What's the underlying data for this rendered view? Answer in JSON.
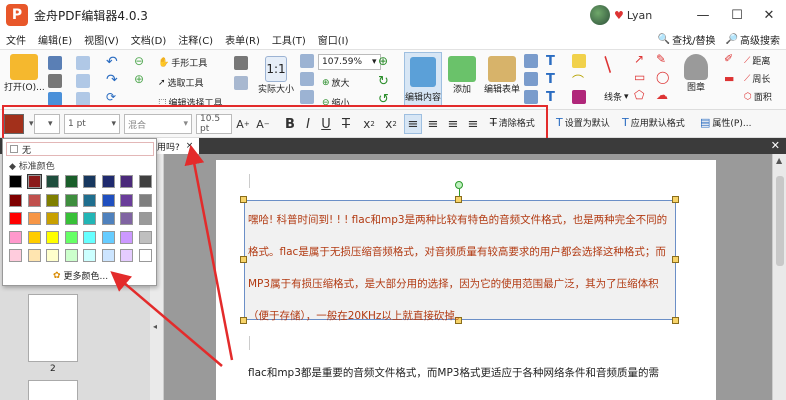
{
  "window": {
    "title": "金舟PDF编辑器4.0.3",
    "logo_letter": "P",
    "username": "Lyan",
    "minimize": "—",
    "maximize": "☐",
    "close": "✕"
  },
  "menu": {
    "items": [
      "文件",
      "编辑(E)",
      "视图(V)",
      "文档(D)",
      "注释(C)",
      "表单(R)",
      "工具(T)",
      "窗口(I)"
    ],
    "find_replace": "查找/替换",
    "advanced_search": "高级搜索"
  },
  "ribbon": {
    "open": "打开(O)...",
    "hand_tool": "手形工具",
    "select_tool": "选取工具",
    "edit_select_tool": "编辑选择工具",
    "actual_size": "实际大小",
    "zoom_value": "107.59%",
    "zoom_in": "放大",
    "zoom_out": "缩小",
    "edit_content": "编辑内容",
    "add": "添加",
    "edit_form": "编辑表单",
    "line": "线条",
    "stamp": "图章",
    "distance": "距离",
    "perimeter": "周长",
    "area": "面积"
  },
  "format": {
    "fill_label": "",
    "line_width": "1 pt",
    "blend": "混合",
    "font_size": "10.5 pt",
    "clear_format": "清除格式",
    "set_default": "设置为默认",
    "apply_default": "应用默认格式",
    "properties": "属性(P)..."
  },
  "tab": {
    "title": "好用吗?",
    "close": "×"
  },
  "color_popup": {
    "none_label": "无",
    "standard_colors": "标准颜色",
    "more_colors": "更多颜色...",
    "swatches": [
      [
        "#000000",
        "#8b1a1a",
        "#1f4e3d",
        "#1a5e2a",
        "#17375e",
        "#1f2a6e",
        "#4b2a7a",
        "#404040"
      ],
      [
        "#7f0000",
        "#c0504d",
        "#7f7f00",
        "#3e8e3e",
        "#1f6e8e",
        "#1f4fbf",
        "#6a3d9a",
        "#7f7f7f"
      ],
      [
        "#ff0000",
        "#f79646",
        "#c8a000",
        "#38c038",
        "#22b5b5",
        "#4f81bd",
        "#8064a2",
        "#9a9a9a"
      ],
      [
        "#ff99cc",
        "#ffcc00",
        "#ffff00",
        "#66ff66",
        "#66ffff",
        "#66ccff",
        "#cc99ff",
        "#bfbfbf"
      ],
      [
        "#ffccdd",
        "#ffe5b0",
        "#ffffcc",
        "#ccffcc",
        "#ccffff",
        "#cce5ff",
        "#e5ccff",
        "#ffffff"
      ]
    ]
  },
  "document": {
    "para1": "嘿哈! 科普时间到! ! ! flac和mp3是两种比较有特色的音频文件格式，也是两种完全不同的格式。flac是属于无损压缩音频格式，对音频质量有较高要求的用户都会选择这种格式；而MP3属于有损压缩格式，是大部分用的选择，因为它的使用范围最广泛，其为了压缩体积（便于存储），一般在20KHz以上就直接砍掉。",
    "para2": "flac和mp3都是重要的音频文件格式，而MP3格式更适应于各种网络条件和音频质量的需",
    "page_number": "2"
  },
  "icons": {
    "tab_close_right": "✕"
  }
}
